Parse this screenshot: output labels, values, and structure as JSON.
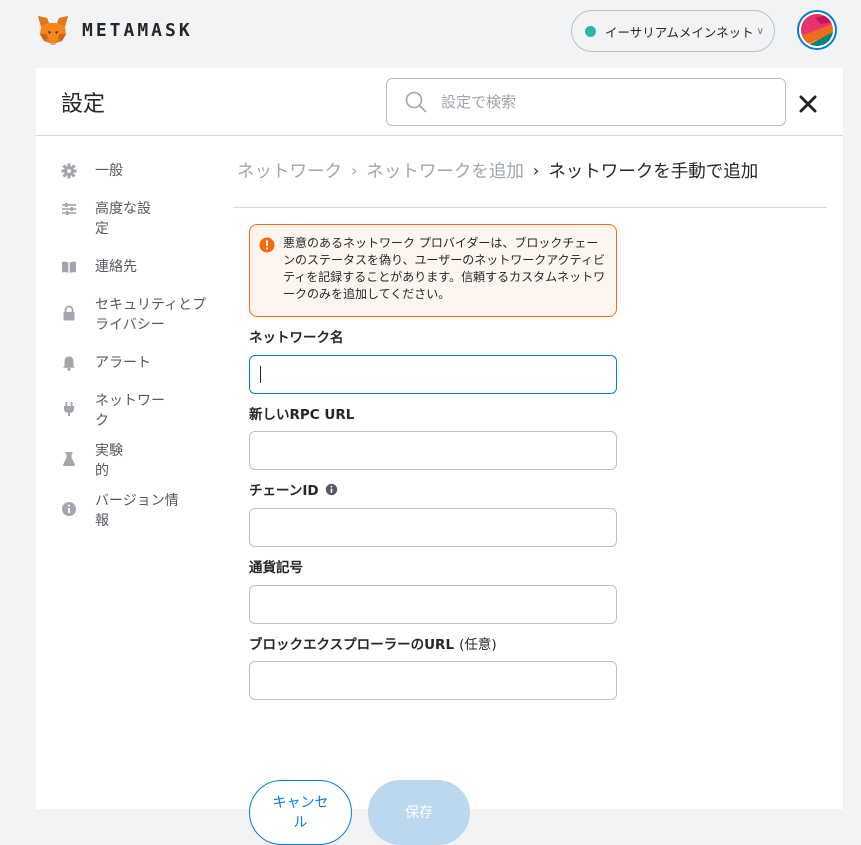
{
  "app": {
    "logo_text": "METAMASK",
    "network_label": "イーサリアムメインネット",
    "network_color": "#29b6af",
    "accent_color": "#037dd6"
  },
  "header": {
    "title": "設定",
    "search_placeholder": "設定で検索"
  },
  "sidebar": {
    "items": [
      {
        "label": "一般",
        "icon": "gear-icon"
      },
      {
        "label": "高度な設定",
        "icon": "sliders-icon"
      },
      {
        "label": "連絡先",
        "icon": "book-icon"
      },
      {
        "label": "セキュリティとプライバシー",
        "icon": "lock-icon"
      },
      {
        "label": "アラート",
        "icon": "bell-icon"
      },
      {
        "label": "ネットワーク",
        "icon": "plug-icon"
      },
      {
        "label": "実験的",
        "icon": "flask-icon"
      },
      {
        "label": "バージョン情報",
        "icon": "info-icon"
      }
    ]
  },
  "breadcrumb": {
    "items": [
      "ネットワーク",
      "ネットワークを追加"
    ],
    "current": "ネットワークを手動で追加"
  },
  "warning": {
    "text": "悪意のあるネットワーク プロバイダーは、ブロックチェーンのステータスを偽り、ユーザーのネットワークアクティビティを記録することがあります。信頼するカスタムネットワークのみを追加してください。",
    "color": "#f66a0a"
  },
  "form": {
    "network_name_label": "ネットワーク名",
    "network_name_value": "",
    "rpc_url_label": "新しいRPC URL",
    "rpc_url_value": "",
    "chain_id_label": "チェーンID",
    "chain_id_value": "",
    "currency_symbol_label": "通貨記号",
    "currency_symbol_value": "",
    "explorer_url_label": "ブロックエクスプローラーのURL",
    "explorer_url_optional": "(任意)",
    "explorer_url_value": ""
  },
  "buttons": {
    "cancel": "キャンセル",
    "save": "保存"
  }
}
